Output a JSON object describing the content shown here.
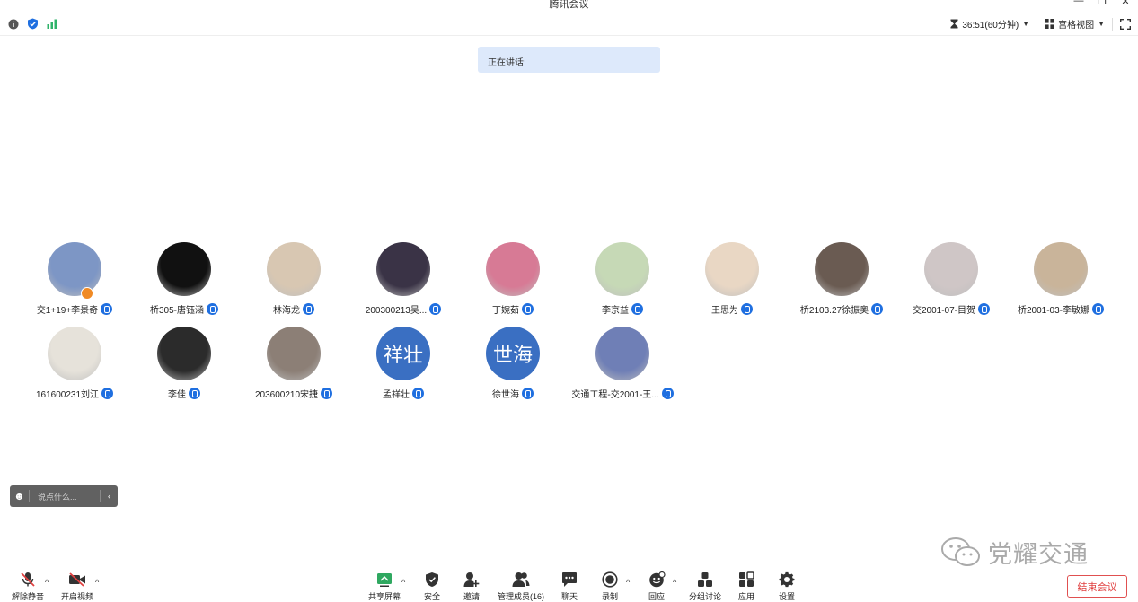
{
  "window": {
    "title": "腾讯会议",
    "minimize": "—",
    "restore": "❐",
    "close": "✕"
  },
  "topbar": {
    "timer": "36:51(60分钟)",
    "view_label": "宫格视图"
  },
  "speaking_label": "正在讲话:",
  "participants": [
    {
      "name": "交1+19+李景奇",
      "avatar_text": "",
      "color": "#7d96c5",
      "host": true
    },
    {
      "name": "桥305-唐钰涵",
      "avatar_text": "",
      "color": "#111111",
      "host": false
    },
    {
      "name": "林海龙",
      "avatar_text": "",
      "color": "#d8c7b2",
      "host": false
    },
    {
      "name": "200300213吴...",
      "avatar_text": "",
      "color": "#3a3346",
      "host": false
    },
    {
      "name": "丁婉茹",
      "avatar_text": "",
      "color": "#d77a95",
      "host": false
    },
    {
      "name": "李京益",
      "avatar_text": "",
      "color": "#c6d9b6",
      "host": false
    },
    {
      "name": "王思为",
      "avatar_text": "",
      "color": "#e9d7c4",
      "host": false
    },
    {
      "name": "桥2103.27徐振奥",
      "avatar_text": "",
      "color": "#6a5b52",
      "host": false
    },
    {
      "name": "交2001-07-目贺",
      "avatar_text": "",
      "color": "#cfc6c6",
      "host": false
    },
    {
      "name": "桥2001-03-李敏娜",
      "avatar_text": "",
      "color": "#c9b49a",
      "host": false
    },
    {
      "name": "161600231刘江",
      "avatar_text": "",
      "color": "#e6e2da",
      "host": false
    },
    {
      "name": "李佳",
      "avatar_text": "",
      "color": "#2b2b2b",
      "host": false
    },
    {
      "name": "203600210宋捷",
      "avatar_text": "",
      "color": "#8c7f76",
      "host": false
    },
    {
      "name": "孟祥壮",
      "avatar_text": "祥壮",
      "color": "#3a6fc2",
      "host": false
    },
    {
      "name": "徐世海",
      "avatar_text": "世海",
      "color": "#3a6fc2",
      "host": false
    },
    {
      "name": "交通工程-交2001-王...",
      "avatar_text": "",
      "color": "#6f7fb6",
      "host": false
    }
  ],
  "chat": {
    "placeholder": "说点什么...",
    "collapse": "‹"
  },
  "watermark": "党耀交通",
  "toolbar": {
    "unmute": "解除静音",
    "start_video": "开启视频",
    "share_screen": "共享屏幕",
    "security": "安全",
    "invite": "邀请",
    "manage_members": "管理成员(16)",
    "chat": "聊天",
    "record": "录制",
    "reactions": "回应",
    "breakout": "分组讨论",
    "apps": "应用",
    "settings": "设置",
    "end_meeting": "结束会议"
  },
  "colors": {
    "accent": "#1f6fe0",
    "signal": "#2fb36a",
    "end": "#e04040"
  }
}
